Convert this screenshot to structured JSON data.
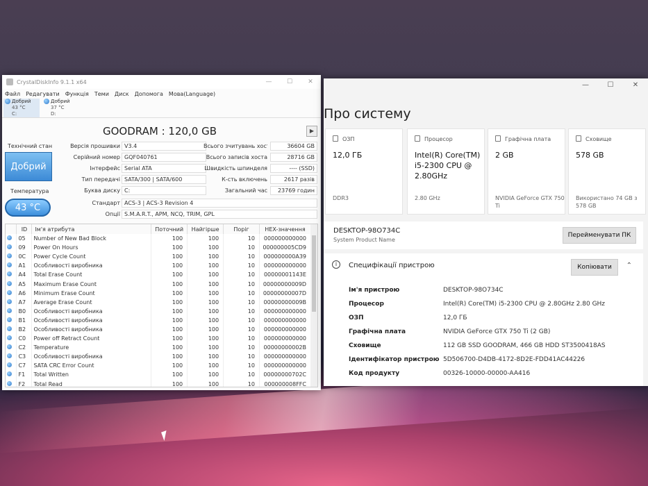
{
  "cdi": {
    "title": "CrystalDiskInfo 9.1.1 x64",
    "controls": {
      "min": "—",
      "max": "☐",
      "close": "✕"
    },
    "menu": [
      "Файл",
      "Редагувати",
      "Функція",
      "Теми",
      "Диск",
      "Допомога",
      "Мова(Language)"
    ],
    "drives": [
      {
        "status": "Добрий",
        "temp": "43 °C",
        "letter": "C:"
      },
      {
        "status": "Добрий",
        "temp": "37 °C",
        "letter": "D:"
      }
    ],
    "model": "GOODRAM : 120,0 GB",
    "play_icon": "▶",
    "health_label": "Технічний стан",
    "health_value": "Добрий",
    "temp_label": "Температура",
    "temp_value": "43 °C",
    "fields": {
      "firmware": {
        "label": "Версія прошивки",
        "value": "V3.4"
      },
      "serial": {
        "label": "Серійний номер",
        "value": "GQF040761"
      },
      "interface": {
        "label": "Інтерфейс",
        "value": "Serial ATA"
      },
      "transfer": {
        "label": "Тип передачі",
        "value": "SATA/300 | SATA/600"
      },
      "letter": {
        "label": "Буква диску",
        "value": "C:"
      },
      "standard": {
        "label": "Стандарт",
        "value": "ACS-3 | ACS-3 Revision 4"
      },
      "features": {
        "label": "Опції",
        "value": "S.M.A.R.T., APM, NCQ, TRIM, GPL"
      },
      "host_reads": {
        "label": "Всього зчитувань хоста",
        "value": "36604 GB"
      },
      "host_writes": {
        "label": "Всього записів хоста",
        "value": "28716 GB"
      },
      "rotation": {
        "label": "Швидкість шпинделя",
        "value": "---- (SSD)"
      },
      "power_count": {
        "label": "К-сть включень",
        "value": "2617 разів"
      },
      "power_hours": {
        "label": "Загальний час",
        "value": "23769 годин"
      }
    },
    "smart_headers": [
      "ID",
      "Ім'я атрибута",
      "Поточний",
      "Найгірше",
      "Поріг",
      "HEX-значення"
    ],
    "smart_rows": [
      [
        "05",
        "Number of New Bad Block",
        "100",
        "100",
        "10",
        "000000000000"
      ],
      [
        "09",
        "Power On Hours",
        "100",
        "100",
        "10",
        "000000005CD9"
      ],
      [
        "0C",
        "Power Cycle Count",
        "100",
        "100",
        "10",
        "000000000A39"
      ],
      [
        "A1",
        "Особливості виробника",
        "100",
        "100",
        "10",
        "000000000000"
      ],
      [
        "A4",
        "Total Erase Count",
        "100",
        "100",
        "10",
        "00000001143E"
      ],
      [
        "A5",
        "Maximum Erase Count",
        "100",
        "100",
        "10",
        "00000000009D"
      ],
      [
        "A6",
        "Minimum Erase Count",
        "100",
        "100",
        "10",
        "00000000007D"
      ],
      [
        "A7",
        "Average Erase Count",
        "100",
        "100",
        "10",
        "00000000009B"
      ],
      [
        "B0",
        "Особливості виробника",
        "100",
        "100",
        "10",
        "000000000000"
      ],
      [
        "B1",
        "Особливості виробника",
        "100",
        "100",
        "10",
        "000000000000"
      ],
      [
        "B2",
        "Особливості виробника",
        "100",
        "100",
        "10",
        "000000000000"
      ],
      [
        "C0",
        "Power off Retract Count",
        "100",
        "100",
        "10",
        "000000000000"
      ],
      [
        "C2",
        "Temperature",
        "100",
        "100",
        "10",
        "00000000002B"
      ],
      [
        "C3",
        "Особливості виробника",
        "100",
        "100",
        "10",
        "000000000000"
      ],
      [
        "C7",
        "SATA CRC Error Count",
        "100",
        "100",
        "10",
        "000000000000"
      ],
      [
        "F1",
        "Total Written",
        "100",
        "100",
        "10",
        "00000000702C"
      ],
      [
        "F2",
        "Total Read",
        "100",
        "100",
        "10",
        "000000008FFC"
      ]
    ]
  },
  "about": {
    "title": "Про систему",
    "controls": {
      "min": "—",
      "max": "☐",
      "close": "✕"
    },
    "cards": [
      {
        "label": "ОЗП",
        "value": "12,0 ГБ",
        "sub": "DDR3"
      },
      {
        "label": "Процесор",
        "value": "Intel(R) Core(TM) i5-2300 CPU @ 2.80GHz",
        "sub": "2.80 GHz"
      },
      {
        "label": "Графічна плата",
        "value": "2 GB",
        "sub": "NVIDIA GeForce GTX 750 Ti"
      },
      {
        "label": "Сховище",
        "value": "578 GB",
        "sub": "Використано 74 GB з 578 GB"
      }
    ],
    "device_name": "DESKTOP-98O734C",
    "device_desc": "System Product Name",
    "rename_button": "Перейменувати ПК",
    "spec_title": "Специфікації пристрою",
    "copy_button": "Копіювати",
    "info_icon": "i",
    "chevron_icon": "⌃",
    "specs": [
      {
        "key": "Ім'я пристрою",
        "value": "DESKTOP-98O734C"
      },
      {
        "key": "Процесор",
        "value": "Intel(R) Core(TM) i5-2300 CPU @ 2.80GHz   2.80 GHz"
      },
      {
        "key": "ОЗП",
        "value": "12,0 ГБ"
      },
      {
        "key": "Графічна плата",
        "value": "NVIDIA GeForce GTX 750 Ti (2 GB)"
      },
      {
        "key": "Сховище",
        "value": "112 GB SSD GOODRAM, 466 GB HDD ST3500418AS"
      },
      {
        "key": "Ідентифікатор пристрою",
        "value": "5D506700-D4DB-4172-8D2E-FDD41AC44226"
      },
      {
        "key": "Код продукту",
        "value": "00326-10000-00000-AA416"
      }
    ]
  }
}
